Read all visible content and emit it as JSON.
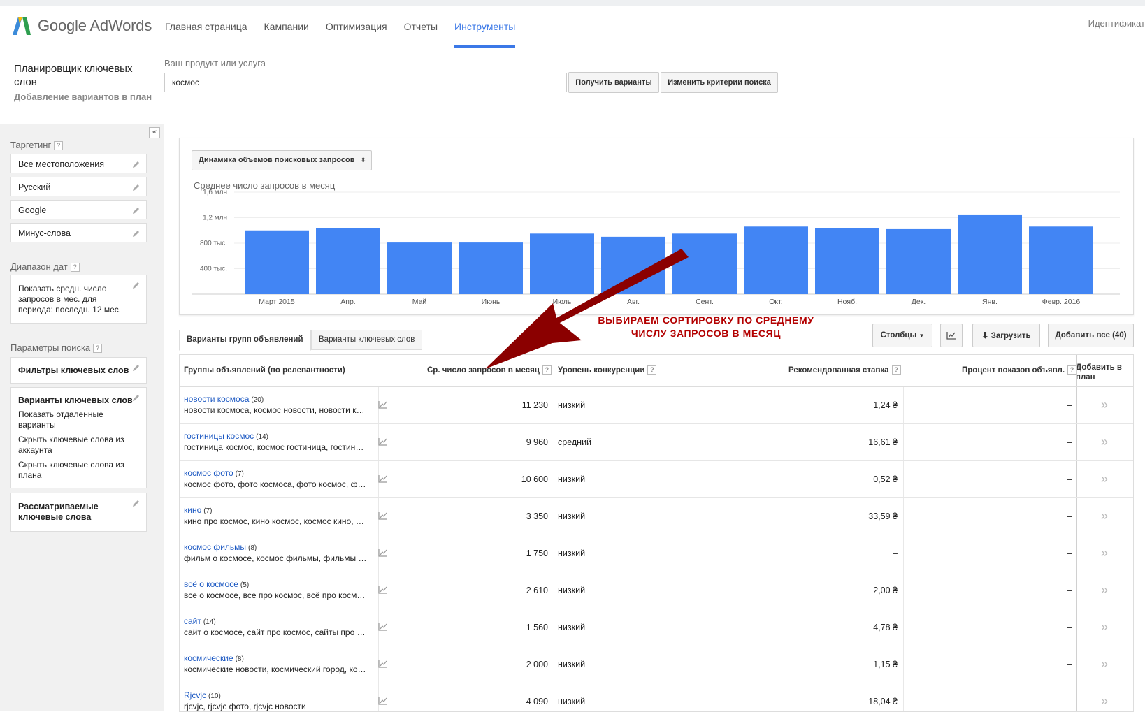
{
  "header": {
    "brand": "Google AdWords",
    "nav": [
      "Главная страница",
      "Кампании",
      "Оптимизация",
      "Отчеты",
      "Инструменты"
    ],
    "active_nav": "Инструменты",
    "account": "Идентификат"
  },
  "planner": {
    "title": "Планировщик ключевых слов",
    "subtitle": "Добавление вариантов в план",
    "product_label": "Ваш продукт или услуга",
    "product_value": "космос",
    "get_ideas": "Получить варианты",
    "modify_search": "Изменить критерии поиска"
  },
  "sidebar": {
    "targeting_label": "Таргетинг",
    "targeting": [
      "Все местоположения",
      "Русский",
      "Google",
      "Минус-слова"
    ],
    "date_label": "Диапазон дат",
    "date_text": "Показать средн. число запросов в мес. для периода: последн. 12 мес.",
    "search_params_label": "Параметры поиска",
    "keyword_filters": "Фильтры ключевых слов",
    "keyword_options": "Варианты ключевых слов",
    "keyword_options_items": [
      "Показать отдаленные варианты",
      "Скрыть ключевые слова из аккаунта",
      "Скрыть ключевые слова из плана"
    ],
    "included": "Рассматриваемые ключевые слова",
    "question": "?"
  },
  "chart_data": {
    "type": "bar",
    "selector_label": "Динамика объемов поисковых запросов",
    "title": "Среднее число запросов в месяц",
    "categories": [
      "Март 2015",
      "Апр.",
      "Май",
      "Июнь",
      "Июль",
      "Авг.",
      "Сент.",
      "Окт.",
      "Нояб.",
      "Дек.",
      "Янв.",
      "Февр. 2016"
    ],
    "values": [
      1000000,
      1040000,
      810000,
      810000,
      950000,
      900000,
      950000,
      1060000,
      1040000,
      1020000,
      1250000,
      1060000
    ],
    "y_ticks": [
      "400 тыс.",
      "800 тыс.",
      "1,2 млн",
      "1,6 млн"
    ],
    "y_tick_values": [
      400000,
      800000,
      1200000,
      1600000
    ],
    "ylim": [
      0,
      1600000
    ],
    "grid": true,
    "bar_color": "#4285f4"
  },
  "tabs": [
    "Варианты групп объявлений",
    "Варианты ключевых слов"
  ],
  "toolbar": {
    "columns": "Столбцы",
    "download": "Загрузить",
    "add_all": "Добавить все (40)"
  },
  "annotation": {
    "line1": "ВЫБИРАЕМ СОРТИРОВКУ ПО СРЕДНЕМУ",
    "line2": "ЧИСЛУ ЗАПРОСОВ В МЕСЯЦ"
  },
  "table": {
    "headers": {
      "group": "Группы объявлений (по релевантности)",
      "avg": "Ср. число запросов в месяц",
      "competition": "Уровень конкуренции",
      "bid": "Рекомендованная ставка",
      "share": "Процент показов объявл.",
      "add": "Добавить в план"
    },
    "rows": [
      {
        "name": "новости космоса",
        "count": "(20)",
        "keywords": "новости космоса, космос новости, новости космос, новости о космосе",
        "avg": "11 230",
        "competition": "низкий",
        "bid": "1,24 ₴",
        "share": "–"
      },
      {
        "name": "гостиницы космос",
        "count": "(14)",
        "keywords": "гостиница космос, космос гостиница, гостиница космос москва",
        "avg": "9 960",
        "competition": "средний",
        "bid": "16,61 ₴",
        "share": "–"
      },
      {
        "name": "космос фото",
        "count": "(7)",
        "keywords": "космос фото, фото космоса, фото космос, фотографии космоса",
        "avg": "10 600",
        "competition": "низкий",
        "bid": "0,52 ₴",
        "share": "–"
      },
      {
        "name": "кино",
        "count": "(7)",
        "keywords": "кино про космос, кино космос, космос кино, фильмы про космос",
        "avg": "3 350",
        "competition": "низкий",
        "bid": "33,59 ₴",
        "share": "–"
      },
      {
        "name": "космос фильмы",
        "count": "(8)",
        "keywords": "фильм о космосе, космос фильмы, фильмы о космосе, фильм космос",
        "avg": "1 750",
        "competition": "низкий",
        "bid": "–",
        "share": "–"
      },
      {
        "name": "всё о космосе",
        "count": "(5)",
        "keywords": "все о космосе, все про космос, всё про космос, всё о космосе",
        "avg": "2 610",
        "competition": "низкий",
        "bid": "2,00 ₴",
        "share": "–"
      },
      {
        "name": "сайт",
        "count": "(14)",
        "keywords": "сайт о космосе, сайт про космос, сайты про космос, сайт космос",
        "avg": "1 560",
        "competition": "низкий",
        "bid": "4,78 ₴",
        "share": "–"
      },
      {
        "name": "космические",
        "count": "(8)",
        "keywords": "космические новости, космический город, космические фото",
        "avg": "2 000",
        "competition": "низкий",
        "bid": "1,15 ₴",
        "share": "–"
      },
      {
        "name": "Rjcvjc",
        "count": "(10)",
        "keywords": "rjcvjc, rjcvjc фото, rjcvjc новости",
        "avg": "4 090",
        "competition": "низкий",
        "bid": "18,04 ₴",
        "share": "–"
      }
    ]
  }
}
